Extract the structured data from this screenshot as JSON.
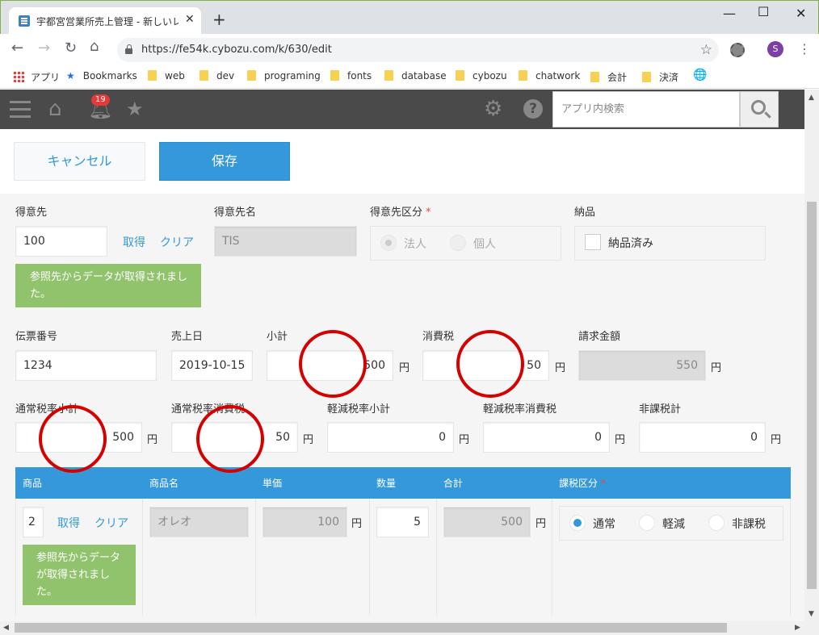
{
  "browser": {
    "tab_title": "宇都宮営業所売上管理 - 新しいレコ",
    "url": "https://fe54k.cybozu.com/k/630/edit",
    "profile_initial": "S"
  },
  "bookmarks": [
    "アプリ",
    "Bookmarks",
    "web",
    "dev",
    "programing",
    "fonts",
    "database",
    "cybozu",
    "chatwork",
    "会計",
    "決済"
  ],
  "header": {
    "notification_count": "19",
    "search_placeholder": "アプリ内検索"
  },
  "actions": {
    "cancel": "キャンセル",
    "save": "保存"
  },
  "form": {
    "customer": {
      "label": "得意先",
      "value": "100",
      "get": "取得",
      "clear": "クリア",
      "message": "参照先からデータが取得されました。"
    },
    "customer_name": {
      "label": "得意先名",
      "value": "TIS"
    },
    "customer_type": {
      "label": "得意先区分",
      "options": [
        "法人",
        "個人"
      ],
      "selected": "法人"
    },
    "delivery": {
      "label": "納品",
      "option": "納品済み",
      "checked": false
    },
    "slip_no": {
      "label": "伝票番号",
      "value": "1234"
    },
    "sales_date": {
      "label": "売上日",
      "value": "2019-10-15"
    },
    "subtotal": {
      "label": "小計",
      "value": "500",
      "unit": "円"
    },
    "tax": {
      "label": "消費税",
      "value": "50",
      "unit": "円"
    },
    "billing": {
      "label": "請求金額",
      "value": "550",
      "unit": "円"
    },
    "std_subtotal": {
      "label": "通常税率小計",
      "value": "500",
      "unit": "円"
    },
    "std_tax": {
      "label": "通常税率消費税",
      "value": "50",
      "unit": "円"
    },
    "red_subtotal": {
      "label": "軽減税率小計",
      "value": "0",
      "unit": "円"
    },
    "red_tax": {
      "label": "軽減税率消費税",
      "value": "0",
      "unit": "円"
    },
    "nontax_total": {
      "label": "非課税計",
      "value": "0",
      "unit": "円"
    }
  },
  "table": {
    "headers": [
      "商品",
      "商品名",
      "単価",
      "数量",
      "合計",
      "課税区分"
    ],
    "row": {
      "product": "2",
      "get": "取得",
      "clear": "クリア",
      "message": "参照先からデータが取得されました。",
      "product_name": "オレオ",
      "unit_price": "100",
      "unit_price_unit": "円",
      "quantity": "5",
      "total": "500",
      "total_unit": "円",
      "tax_options": [
        "通常",
        "軽減",
        "非課税"
      ],
      "tax_selected": "通常"
    }
  },
  "colors": {
    "accent": "#3498db",
    "header_bg": "#4a4a4a",
    "message_bg": "#91c36c",
    "annotation": "#d50000"
  }
}
